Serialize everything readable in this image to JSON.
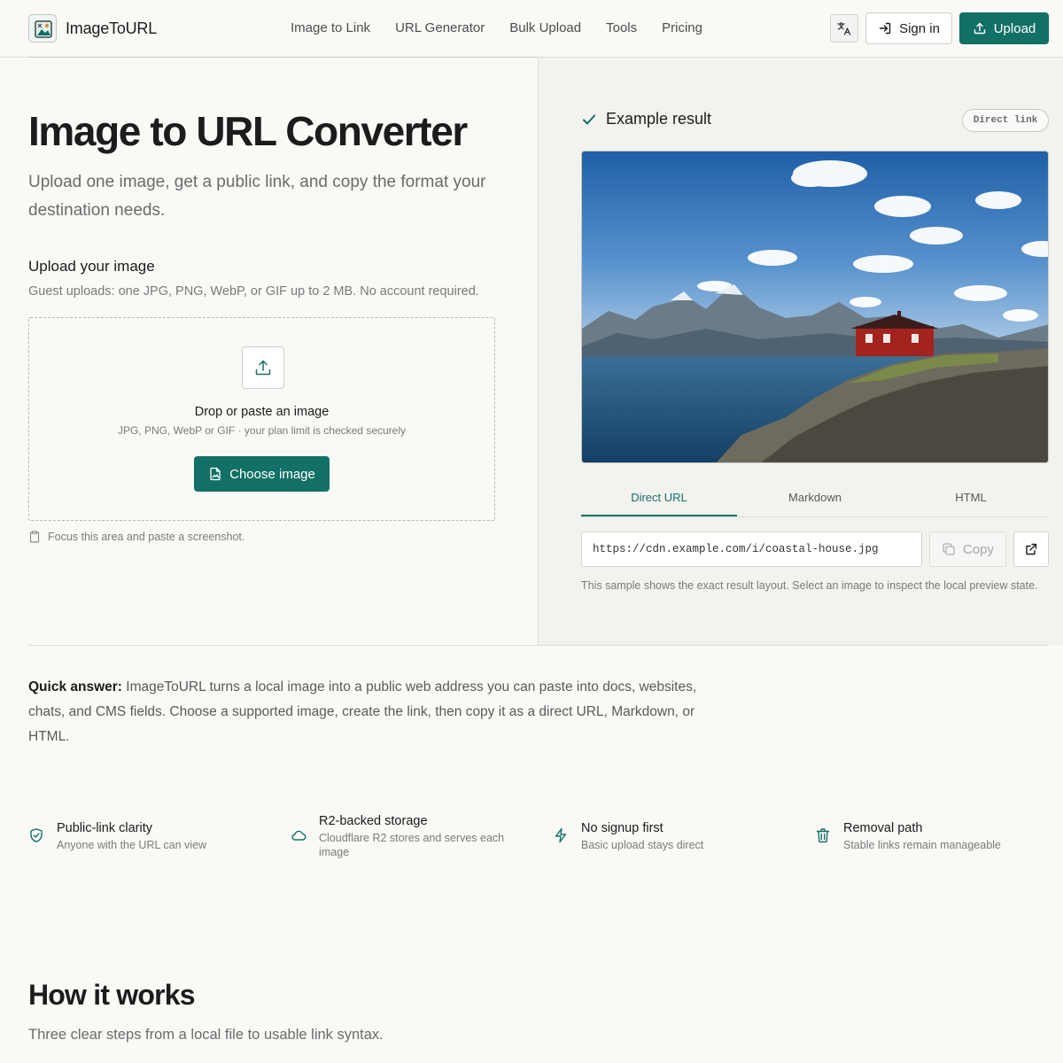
{
  "brand": {
    "name": "ImageToURL"
  },
  "nav": {
    "items": [
      "Image to Link",
      "URL Generator",
      "Bulk Upload",
      "Tools",
      "Pricing"
    ]
  },
  "header": {
    "signin_label": "Sign in",
    "upload_label": "Upload"
  },
  "hero": {
    "title": "Image to URL Converter",
    "subtitle": "Upload one image, get a public link, and copy the format your destination needs."
  },
  "upload": {
    "heading": "Upload your image",
    "note": "Guest uploads: one JPG, PNG, WebP, or GIF up to 2 MB. No account required.",
    "drop_title": "Drop or paste an image",
    "drop_sub": "JPG, PNG, WebP or GIF · your plan limit is checked securely",
    "choose_label": "Choose image",
    "paste_hint": "Focus this area and paste a screenshot."
  },
  "example": {
    "heading": "Example result",
    "badge": "Direct link",
    "tabs": [
      "Direct URL",
      "Markdown",
      "HTML"
    ],
    "active_tab": "Direct URL",
    "url": "https://cdn.example.com/i/coastal-house.jpg",
    "copy_label": "Copy",
    "note": "This sample shows the exact result layout. Select an image to inspect the local preview state."
  },
  "quick_answer": {
    "label": "Quick answer:",
    "text": "ImageToURL turns a local image into a public web address you can paste into docs, websites, chats, and CMS fields. Choose a supported image, create the link, then copy it as a direct URL, Markdown, or HTML."
  },
  "features": [
    {
      "title": "Public-link clarity",
      "desc": "Anyone with the URL can view",
      "icon": "shield-check-icon"
    },
    {
      "title": "R2-backed storage",
      "desc": "Cloudflare R2 stores and serves each image",
      "icon": "cloud-icon"
    },
    {
      "title": "No signup first",
      "desc": "Basic upload stays direct",
      "icon": "lightning-icon"
    },
    {
      "title": "Removal path",
      "desc": "Stable links remain manageable",
      "icon": "trash-icon"
    }
  ],
  "how": {
    "title": "How it works",
    "subtitle": "Three clear steps from a local file to usable link syntax."
  },
  "colors": {
    "accent": "#137066",
    "background": "#faf9f6",
    "panel": "#f2f2ef"
  }
}
